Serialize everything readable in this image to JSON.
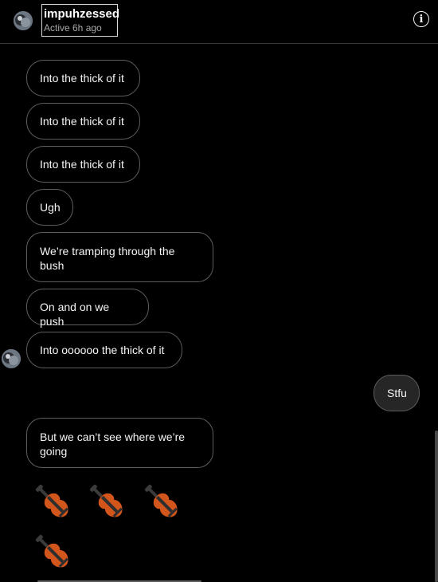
{
  "header": {
    "name": "impuhzessed",
    "status": "Active 6h ago"
  },
  "messages": [
    {
      "text": "Into the thick of it",
      "from": "them"
    },
    {
      "text": "Into the thick of it",
      "from": "them"
    },
    {
      "text": "Into the thick of it",
      "from": "them"
    },
    {
      "text": "Ugh",
      "from": "them"
    },
    {
      "text": "We’re tramping through the bush",
      "from": "them"
    },
    {
      "text": "On and on we push",
      "from": "them"
    },
    {
      "text": "Into oooooo the thick of it",
      "from": "them"
    },
    {
      "text": "Stfu",
      "from": "me"
    },
    {
      "text": "But we can’t see where we’re going",
      "from": "them"
    }
  ],
  "emoji_message": {
    "emoji": "violin",
    "count": 4
  },
  "colors": {
    "background": "#000000",
    "bubble_border": "#5e5e5e",
    "my_bubble": "#262626",
    "violin_body": "#d2551b"
  }
}
